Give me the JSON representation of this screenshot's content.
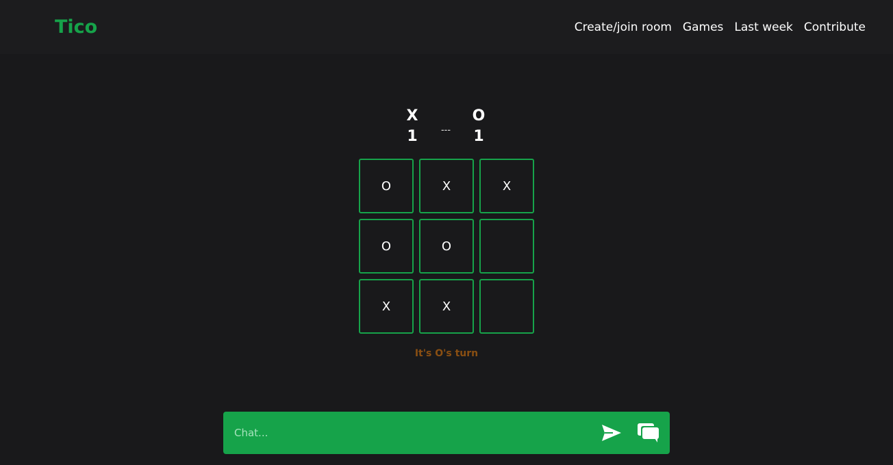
{
  "brand": "Tico",
  "nav": {
    "links": [
      "Create/join room",
      "Games",
      "Last week",
      "Contribute"
    ]
  },
  "score": {
    "x_label": "X",
    "x_score": "1",
    "separator": "---",
    "o_label": "O",
    "o_score": "1"
  },
  "board": {
    "cells": [
      "O",
      "X",
      "X",
      "O",
      "O",
      "",
      "X",
      "X",
      ""
    ]
  },
  "status": {
    "turn_text": "It's O's turn"
  },
  "chat": {
    "placeholder": "Chat...",
    "send_icon": "send-icon",
    "chats_icon": "chat-bubbles-icon"
  },
  "colors": {
    "accent": "#16a34a",
    "turn_text": "#8a4f12",
    "background": "#19191b"
  }
}
